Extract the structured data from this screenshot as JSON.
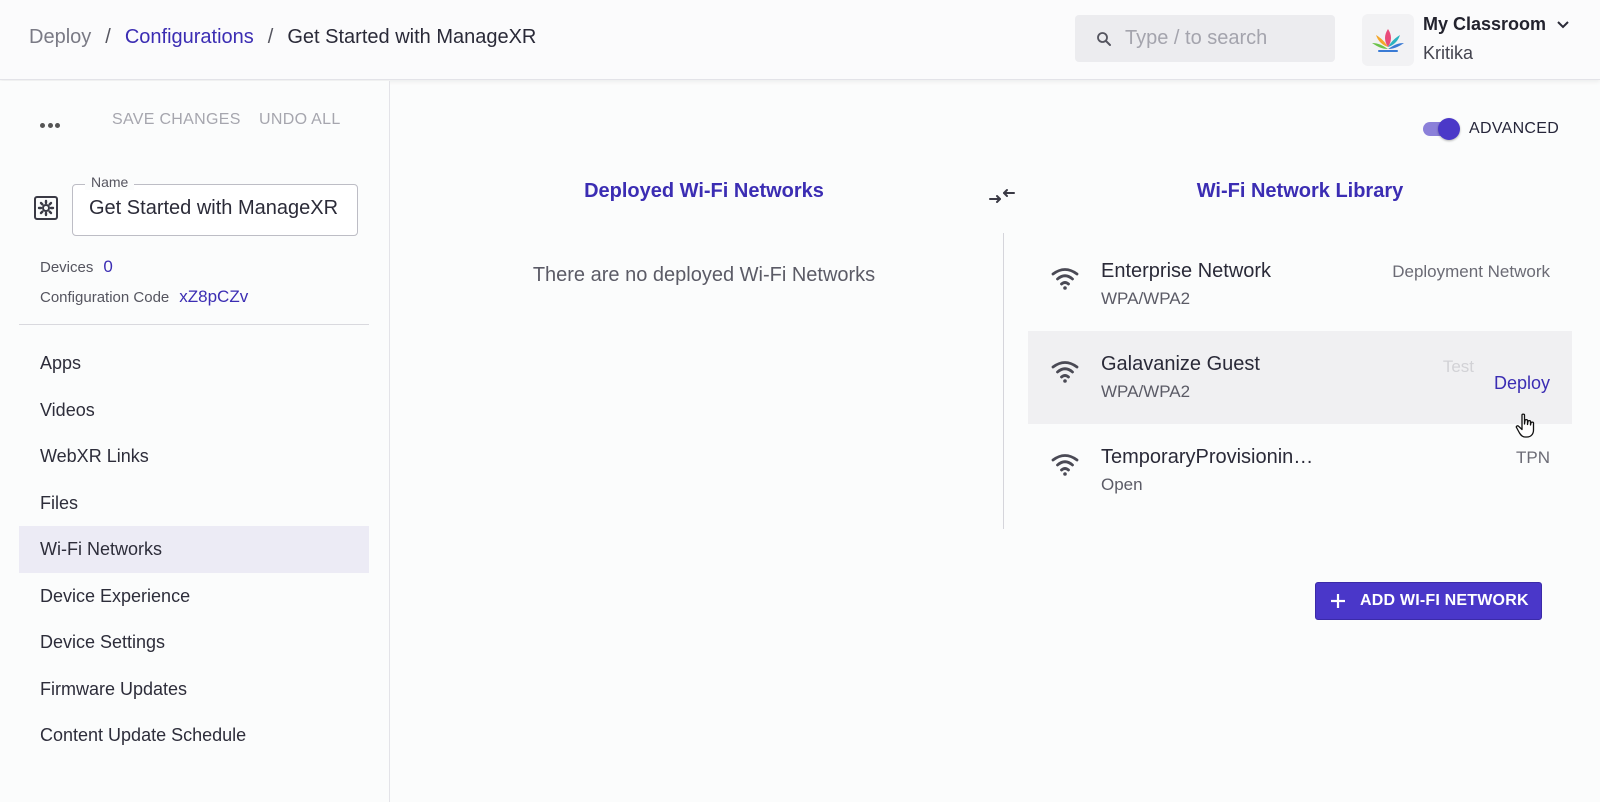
{
  "breadcrumb": {
    "root": "Deploy",
    "link": "Configurations",
    "current": "Get Started with ManageXR"
  },
  "search": {
    "placeholder": "Type / to search",
    "icon": "search-icon"
  },
  "org": {
    "name": "My Classroom",
    "user": "Kritika",
    "icon": "lotus-logo"
  },
  "sidebar": {
    "actions": {
      "save": "SAVE CHANGES",
      "undo": "UNDO ALL"
    },
    "name_label": "Name",
    "name_value": "Get Started with ManageXR",
    "devices_label": "Devices",
    "devices_value": "0",
    "code_label": "Configuration Code",
    "code_value": "xZ8pCZv",
    "items": [
      {
        "label": "Apps"
      },
      {
        "label": "Videos"
      },
      {
        "label": "WebXR Links"
      },
      {
        "label": "Files"
      },
      {
        "label": "Wi-Fi Networks",
        "active": true
      },
      {
        "label": "Device Experience"
      },
      {
        "label": "Device Settings"
      },
      {
        "label": "Firmware Updates"
      },
      {
        "label": "Content Update Schedule"
      }
    ]
  },
  "main": {
    "advanced_label": "ADVANCED",
    "advanced_on": true,
    "deployed_title": "Deployed Wi-Fi Networks",
    "empty_message": "There are no deployed Wi-Fi Networks",
    "library_title": "Wi-Fi Network Library",
    "networks": [
      {
        "name": "Enterprise Network",
        "security": "WPA/WPA2",
        "tag": "Deployment Network"
      },
      {
        "name": "Galavanize Guest",
        "security": "WPA/WPA2",
        "tag": "Test",
        "action": "Deploy"
      },
      {
        "name": "TemporaryProvisionin…",
        "security": "Open",
        "tag": "TPN"
      }
    ],
    "add_button": "ADD WI-FI NETWORK"
  },
  "colors": {
    "accent": "#4a37c9",
    "link": "#3b2db3",
    "active_nav": "#ecebf5"
  }
}
